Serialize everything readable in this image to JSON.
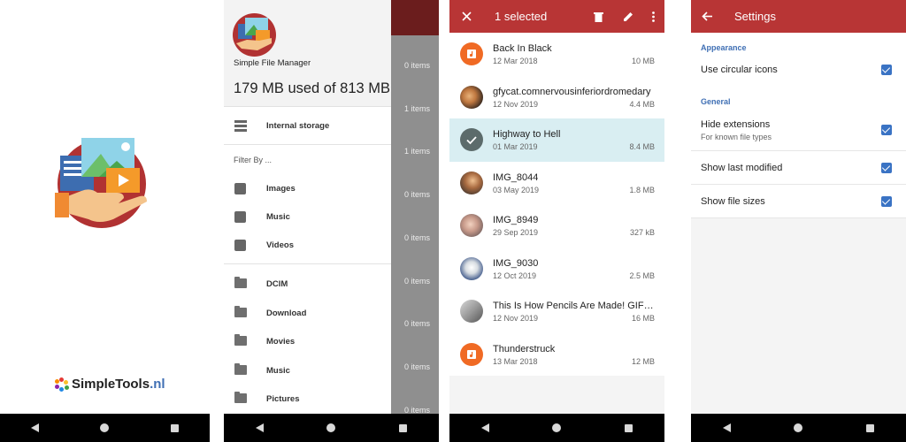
{
  "splash": {
    "brand_part1": "SimpleTools",
    "brand_part2": ".nl"
  },
  "drawer": {
    "app_name": "Simple File Manager",
    "usage": "179 MB used of 813 MB",
    "internal_storage": "Internal storage",
    "filter_label": "Filter By ...",
    "filters": [
      "Images",
      "Music",
      "Videos"
    ],
    "folders": [
      "DCIM",
      "Download",
      "Movies",
      "Music",
      "Pictures"
    ],
    "behind_counts": [
      "0 items",
      "1 items",
      "1 items",
      "0 items",
      "0 items",
      "0 items",
      "0 items",
      "0 items",
      "0 items"
    ]
  },
  "selection": {
    "title": "1 selected",
    "files": [
      {
        "name": "Back In Black",
        "date": "12 Mar 2018",
        "size": "10 MB",
        "thumb": "music"
      },
      {
        "name": "gfycat.comnervousinferiordromedary",
        "date": "12 Nov 2019",
        "size": "4.4 MB",
        "thumb": "photo"
      },
      {
        "name": "Highway to Hell",
        "date": "01 Mar 2019",
        "size": "8.4 MB",
        "thumb": "selected"
      },
      {
        "name": "IMG_8044",
        "date": "03 May 2019",
        "size": "1.8 MB",
        "thumb": "photo"
      },
      {
        "name": "IMG_8949",
        "date": "29 Sep 2019",
        "size": "327 kB",
        "thumb": "photo"
      },
      {
        "name": "IMG_9030",
        "date": "12 Oct 2019",
        "size": "2.5 MB",
        "thumb": "photo"
      },
      {
        "name": "This Is How Pencils Are Made! GIF G...",
        "date": "12 Nov 2019",
        "size": "16 MB",
        "thumb": "photo"
      },
      {
        "name": "Thunderstruck",
        "date": "13 Mar 2018",
        "size": "12 MB",
        "thumb": "music"
      }
    ]
  },
  "settings": {
    "title": "Settings",
    "section_appearance": "Appearance",
    "use_circular_icons": "Use circular icons",
    "section_general": "General",
    "hide_extensions": "Hide extensions",
    "hide_extensions_sub": "For known file types",
    "show_last_modified": "Show last modified",
    "show_file_sizes": "Show file sizes"
  },
  "colors": {
    "accent": "#b83535",
    "selection_bg": "#d9eef2",
    "checkbox": "#3a73c4",
    "music_icon": "#f06a24"
  }
}
